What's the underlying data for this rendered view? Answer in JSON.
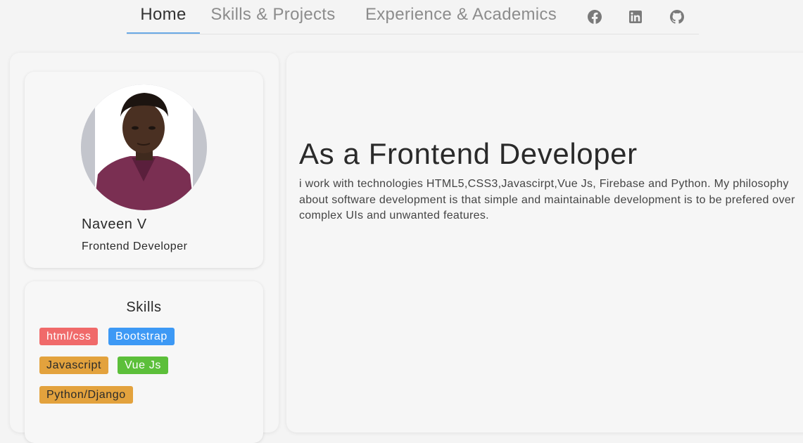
{
  "nav": {
    "tabs": [
      {
        "label": "Home",
        "active": true
      },
      {
        "label": "Skills & Projects",
        "active": false
      },
      {
        "label": "Experience & Academics",
        "active": false
      }
    ],
    "social": [
      {
        "icon": "facebook-icon"
      },
      {
        "icon": "linkedin-icon"
      },
      {
        "icon": "github-icon"
      }
    ],
    "accent_color": "#6aa9e6"
  },
  "profile": {
    "name": "Naveen V",
    "role": "Frontend Developer"
  },
  "skills": {
    "title": "Skills",
    "items": [
      {
        "label": "html/css",
        "color": "#f06a6a"
      },
      {
        "label": "Bootstrap",
        "color": "#3d99f5"
      },
      {
        "label": "Javascript",
        "color": "#e3a23d"
      },
      {
        "label": "Vue Js",
        "color": "#5cbf3a"
      },
      {
        "label": "Python/Django",
        "color": "#e3a23d"
      }
    ]
  },
  "main": {
    "headline": "As a Frontend Developer",
    "bio": "i work with technologies HTML5,CSS3,Javascirpt,Vue Js, Firebase and Python. My philosophy about software development is that simple and maintainable development is to be prefered over complex UIs and unwanted features."
  }
}
